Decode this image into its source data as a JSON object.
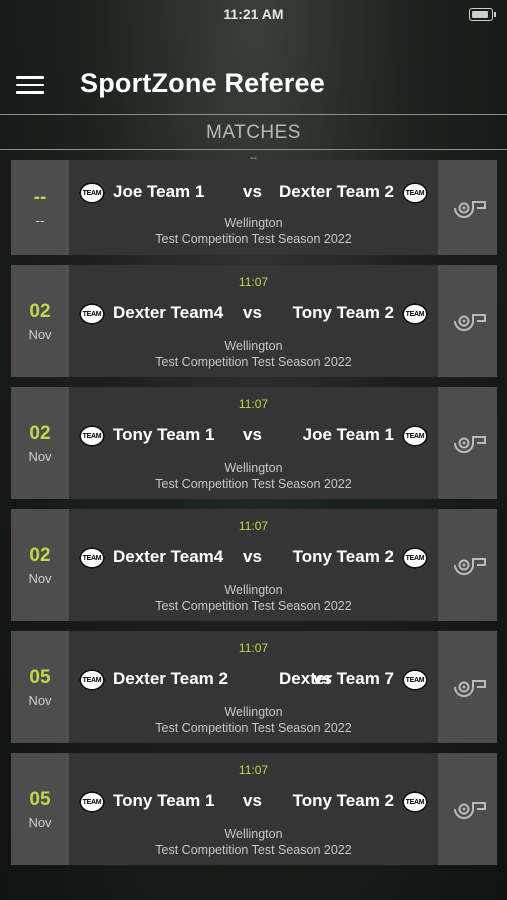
{
  "status_bar": {
    "time": "11:21 AM"
  },
  "header": {
    "title": "SportZone Referee"
  },
  "section": {
    "title": "MATCHES"
  },
  "top_marker": "--",
  "colors": {
    "accent": "#c0d84a",
    "card_body": "#353535",
    "card_side": "#4d4d4d"
  },
  "matches": [
    {
      "day": "--",
      "month": "--",
      "time": "",
      "home": "Joe Team 1",
      "vs": "vs",
      "away": "Dexter Team 2",
      "venue": "Wellington",
      "competition": "Test Competition Test Season 2022"
    },
    {
      "day": "02",
      "month": "Nov",
      "time": "11:07",
      "home": "Dexter Team4",
      "vs": "vs",
      "away": "Tony Team 2",
      "venue": "Wellington",
      "competition": "Test Competition Test Season 2022"
    },
    {
      "day": "02",
      "month": "Nov",
      "time": "11:07",
      "home": "Tony Team 1",
      "vs": "vs",
      "away": "Joe Team 1",
      "venue": "Wellington",
      "competition": "Test Competition Test Season 2022"
    },
    {
      "day": "02",
      "month": "Nov",
      "time": "11:07",
      "home": "Dexter Team4",
      "vs": "vs",
      "away": "Tony Team 2",
      "venue": "Wellington",
      "competition": "Test Competition Test Season 2022"
    },
    {
      "day": "05",
      "month": "Nov",
      "time": "11:07",
      "home": "Dexter Team 2",
      "vs": "vs",
      "away": "Dexter Team 7",
      "venue": "Wellington",
      "competition": "Test Competition Test Season 2022"
    },
    {
      "day": "05",
      "month": "Nov",
      "time": "11:07",
      "home": "Tony Team 1",
      "vs": "vs",
      "away": "Tony Team 2",
      "venue": "Wellington",
      "competition": "Test Competition Test Season 2022"
    }
  ],
  "badge_text": "TEAM",
  "icons": {
    "menu": "hamburger-menu-icon",
    "whistle": "whistle-icon"
  }
}
